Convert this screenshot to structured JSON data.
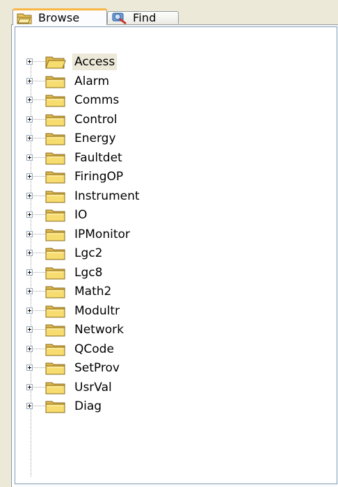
{
  "tabs": [
    {
      "label": "Browse",
      "icon": "open-folder-icon",
      "active": true
    },
    {
      "label": "Find",
      "icon": "find-magnifier-icon",
      "active": false
    }
  ],
  "tree": {
    "selected": "Access",
    "items": [
      {
        "label": "Access"
      },
      {
        "label": "Alarm"
      },
      {
        "label": "Comms"
      },
      {
        "label": "Control"
      },
      {
        "label": "Energy"
      },
      {
        "label": "Faultdet"
      },
      {
        "label": "FiringOP"
      },
      {
        "label": "Instrument"
      },
      {
        "label": "IO"
      },
      {
        "label": "IPMonitor"
      },
      {
        "label": "Lgc2"
      },
      {
        "label": "Lgc8"
      },
      {
        "label": "Math2"
      },
      {
        "label": "Modultr"
      },
      {
        "label": "Network"
      },
      {
        "label": "QCode"
      },
      {
        "label": "SetProv"
      },
      {
        "label": "UsrVal"
      },
      {
        "label": "Diag"
      }
    ]
  },
  "colors": {
    "active_tab_accent": "#f9b643",
    "folder_yellow": "#f7dc6f",
    "selection_bg": "#ece9d8"
  }
}
